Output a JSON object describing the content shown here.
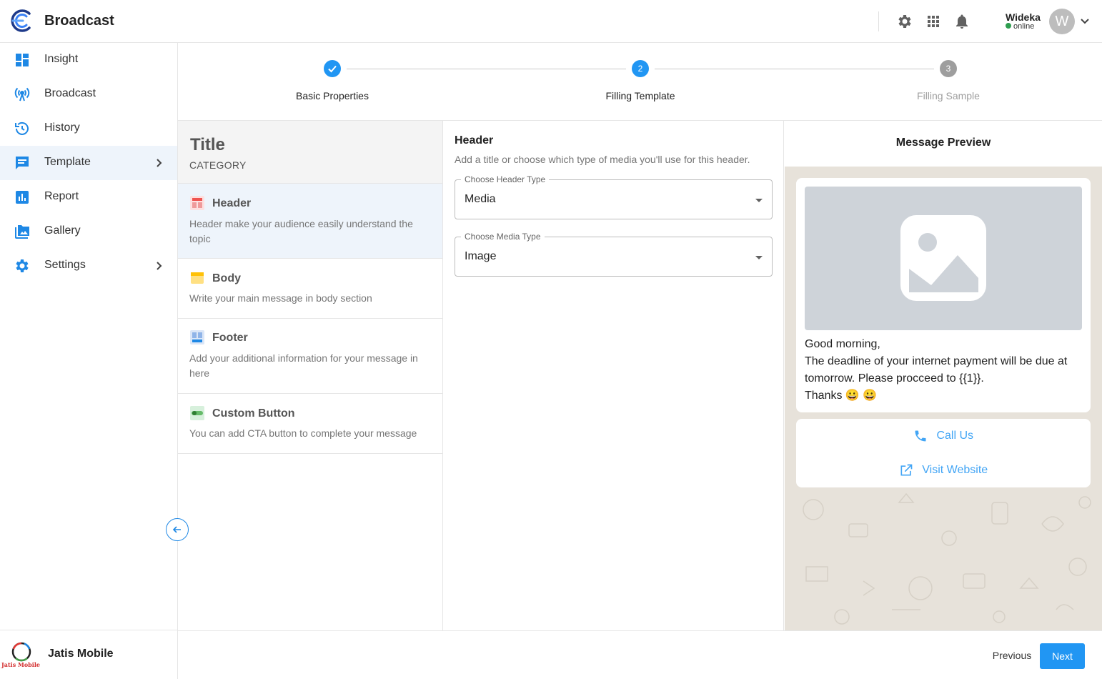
{
  "app": {
    "title": "Broadcast",
    "user_name": "Wideka",
    "user_status": "online",
    "avatar_initial": "W",
    "top_icons": [
      "gear-icon",
      "apps-grid-icon",
      "bell-icon"
    ]
  },
  "sidebar": {
    "items": [
      {
        "label": "Insight",
        "icon": "dashboard-icon"
      },
      {
        "label": "Broadcast",
        "icon": "broadcast-icon"
      },
      {
        "label": "History",
        "icon": "history-icon"
      },
      {
        "label": "Template",
        "icon": "template-icon",
        "active": true,
        "has_submenu": true
      },
      {
        "label": "Report",
        "icon": "report-icon"
      },
      {
        "label": "Gallery",
        "icon": "gallery-icon"
      },
      {
        "label": "Settings",
        "icon": "settings-icon",
        "has_submenu": true
      }
    ],
    "footer_name": "Jatis Mobile",
    "footer_logo_text": "Jatis Mobile"
  },
  "stepper": {
    "steps": [
      {
        "number": "1",
        "label": "Basic Properties",
        "state": "completed"
      },
      {
        "number": "2",
        "label": "Filling Template",
        "state": "active"
      },
      {
        "number": "3",
        "label": "Filling Sample",
        "state": "pending"
      }
    ]
  },
  "categories": {
    "title": "Title",
    "subtitle": "CATEGORY",
    "items": [
      {
        "name": "Header",
        "desc": "Header make your audience easily understand the topic",
        "active": true
      },
      {
        "name": "Body",
        "desc": "Write your main message in body section"
      },
      {
        "name": "Footer",
        "desc": "Add your additional information for your message in here"
      },
      {
        "name": "Custom Button",
        "desc": "You can add CTA button to complete your message"
      }
    ]
  },
  "form": {
    "title": "Header",
    "description": "Add a title or choose which type of media you'll use for this header.",
    "header_type": {
      "label": "Choose Header Type",
      "value": "Media"
    },
    "media_type": {
      "label": "Choose Media Type",
      "value": "Image"
    }
  },
  "preview": {
    "title": "Message Preview",
    "message_lines": [
      "Good morning,",
      "The deadline of your internet payment will be due at tomorrow. Please procceed to {{1}}.",
      "Thanks 😀 😀"
    ],
    "buttons": [
      {
        "label": "Call Us",
        "icon": "phone-icon"
      },
      {
        "label": "Visit Website",
        "icon": "external-link-icon"
      }
    ]
  },
  "footer_actions": {
    "previous": "Previous",
    "next": "Next"
  },
  "colors": {
    "primary": "#2196f3",
    "active_bg": "#eef4fb",
    "online": "#2e9e4f",
    "pending_step": "#9e9e9e",
    "preview_bg": "#e7e2da"
  }
}
